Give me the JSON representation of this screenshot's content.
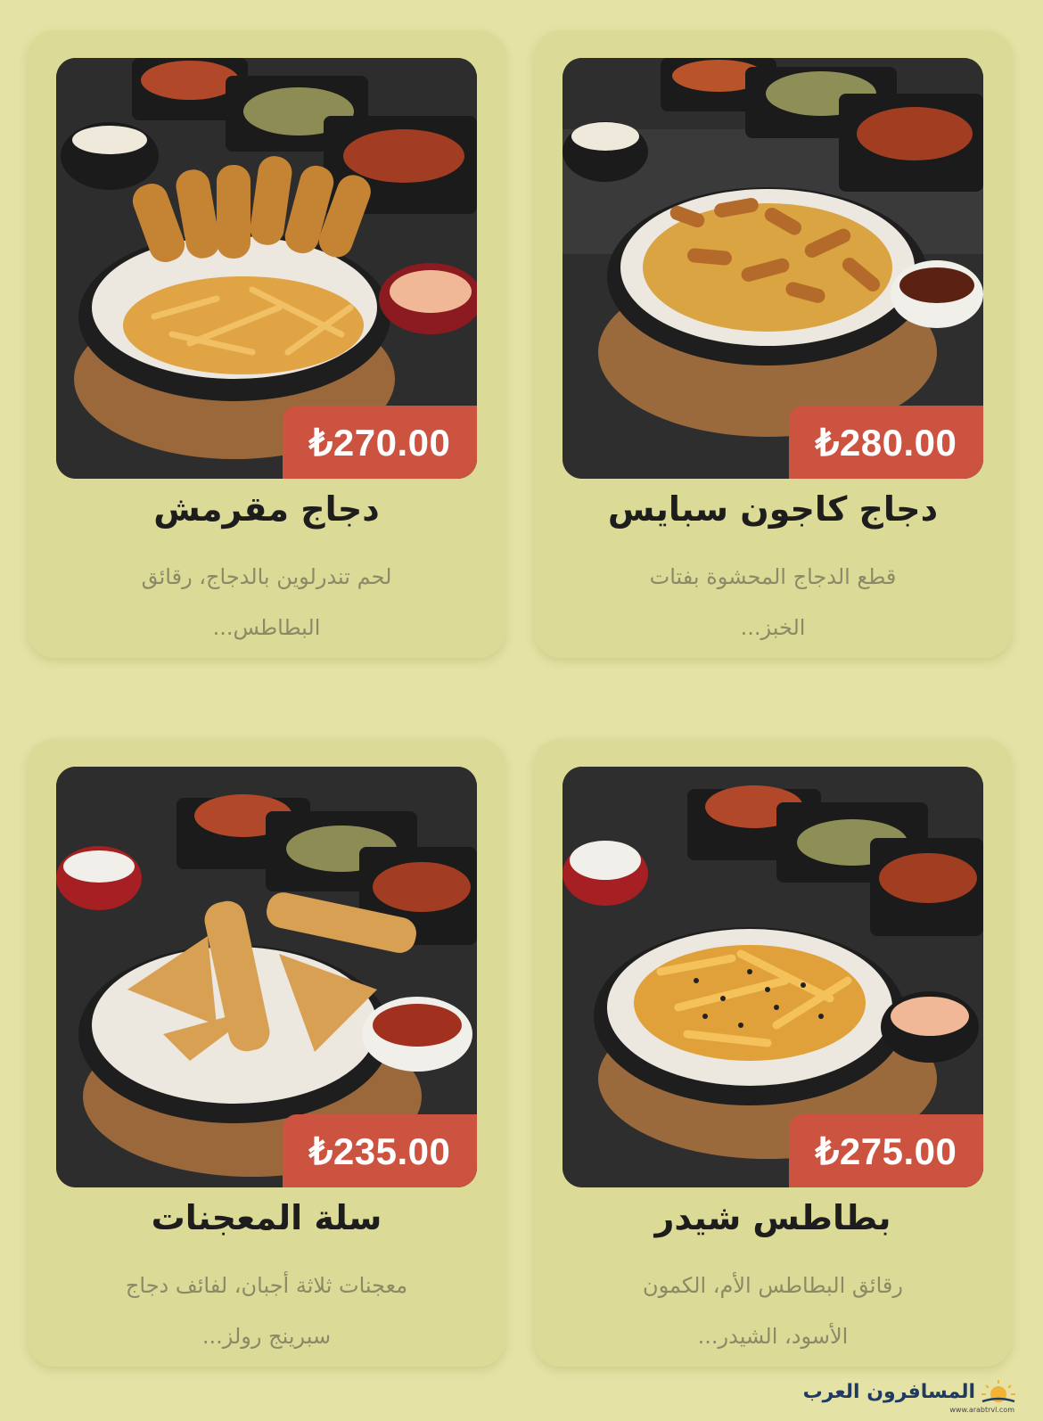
{
  "colors": {
    "page_bg": "#e4e2a4",
    "card_bg": "#dcda97",
    "price_bg": "#cc5340",
    "title": "#1d1d1d",
    "desc": "#8c8a66"
  },
  "menu_items": [
    {
      "name": "دجاج كاجون سبايس",
      "price": "₺280.00",
      "desc_line1": "قطع الدجاج المحشوة بفتات",
      "desc_line2": "الخبز...",
      "image_icon": "cajun-chicken-fries-photo"
    },
    {
      "name": "دجاج مقرمش",
      "price": "₺270.00",
      "desc_line1": "لحم تندرلوين بالدجاج، رقائق",
      "desc_line2": "البطاطس...",
      "image_icon": "crispy-chicken-tenders-photo"
    },
    {
      "name": "بطاطس شيدر",
      "price": "₺275.00",
      "desc_line1": "رقائق البطاطس الأم، الكمون",
      "desc_line2": "الأسود، الشيدر...",
      "image_icon": "cheddar-fries-photo"
    },
    {
      "name": "سلة المعجنات",
      "price": "₺235.00",
      "desc_line1": "معجنات ثلاثة أجبان، لفائف دجاج",
      "desc_line2": "سبرينج رولز...",
      "image_icon": "pastry-basket-photo"
    }
  ],
  "watermark": {
    "text": "المسافرون العرب",
    "sub": "www.arabtrvl.com"
  }
}
